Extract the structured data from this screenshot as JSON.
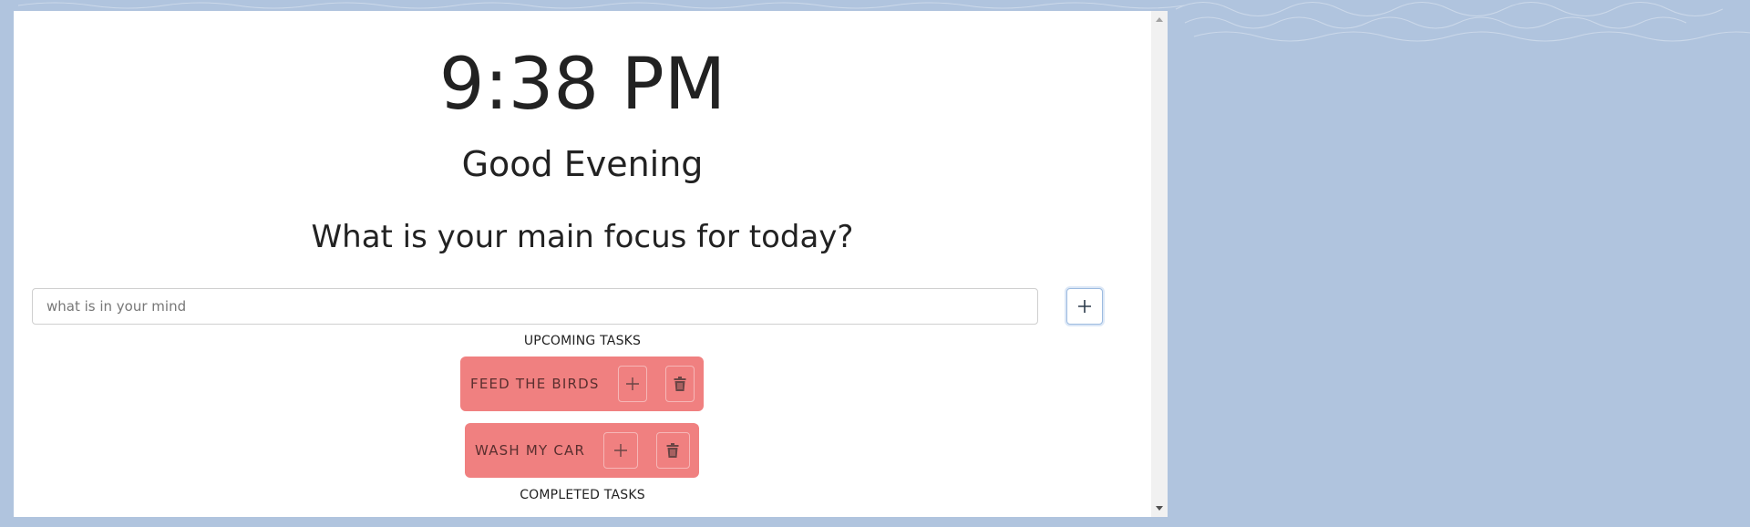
{
  "clock": {
    "time": "9:38 PM"
  },
  "greeting": "Good Evening",
  "focus_question": "What is your main focus for today?",
  "task_input": {
    "placeholder": "what is in your mind",
    "value": ""
  },
  "add_button_icon": "plus-icon",
  "sections": {
    "upcoming_label": "UPCOMING TASKS",
    "completed_label": "COMPLETED TASKS"
  },
  "upcoming_tasks": [
    {
      "text": "FEED THE BIRDS",
      "complete_icon": "plus-icon",
      "delete_icon": "trash-icon"
    },
    {
      "text": "WASH MY CAR",
      "complete_icon": "plus-icon",
      "delete_icon": "trash-icon"
    }
  ],
  "completed_tasks": [],
  "colors": {
    "page_background": "#b0c4de",
    "panel_background": "#ffffff",
    "task_card": "#f08080",
    "text": "#222222"
  }
}
